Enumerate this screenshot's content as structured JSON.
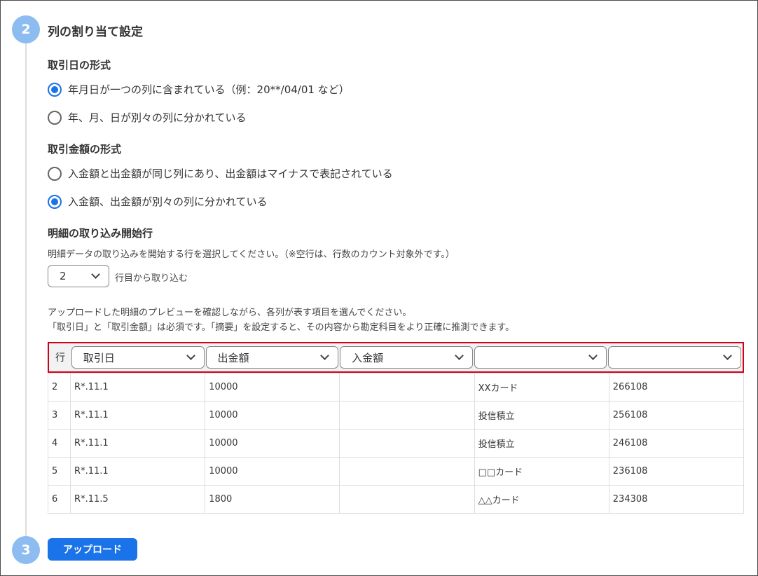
{
  "steps": {
    "step2": "2",
    "step3": "3"
  },
  "section_title": "列の割り当て設定",
  "date_format": {
    "label": "取引日の形式",
    "options": [
      {
        "label": "年月日が一つの列に含まれている（例：20**/04/01 など）",
        "checked": true
      },
      {
        "label": "年、月、日が別々の列に分かれている",
        "checked": false
      }
    ]
  },
  "amount_format": {
    "label": "取引金額の形式",
    "options": [
      {
        "label": "入金額と出金額が同じ列にあり、出金額はマイナスで表記されている",
        "checked": false
      },
      {
        "label": "入金額、出金額が別々の列に分かれている",
        "checked": true
      }
    ]
  },
  "start_row": {
    "label": "明細の取り込み開始行",
    "help": "明細データの取り込みを開始する行を選択してください。（※空行は、行数のカウント対象外です。）",
    "value": "2",
    "suffix": "行目から取り込む"
  },
  "preview_help": {
    "line1": "アップロードした明細のプレビューを確認しながら、各列が表す項目を選んでください。",
    "line2": "「取引日」と「取引金額」は必須です。「摘要」を設定すると、その内容から勘定科目をより正確に推測できます。"
  },
  "mapping": {
    "row_header": "行",
    "columns": [
      "取引日",
      "出金額",
      "入金額",
      "",
      ""
    ]
  },
  "rows": [
    {
      "num": "2",
      "cells": [
        "R*.11.1",
        "10000",
        "",
        "XXカード",
        "266108"
      ]
    },
    {
      "num": "3",
      "cells": [
        "R*.11.1",
        "10000",
        "",
        "投信積立",
        "256108"
      ]
    },
    {
      "num": "4",
      "cells": [
        "R*.11.1",
        "10000",
        "",
        "投信積立",
        "246108"
      ]
    },
    {
      "num": "5",
      "cells": [
        "R*.11.1",
        "10000",
        "",
        "□□カード",
        "236108"
      ]
    },
    {
      "num": "6",
      "cells": [
        "R*.11.5",
        "1800",
        "",
        "△△カード",
        "234308"
      ]
    }
  ],
  "upload_button": "アップロード",
  "colors": {
    "accent": "#1a73e8",
    "step_circle": "#8cbcf0",
    "highlight_border": "#d0021b"
  }
}
